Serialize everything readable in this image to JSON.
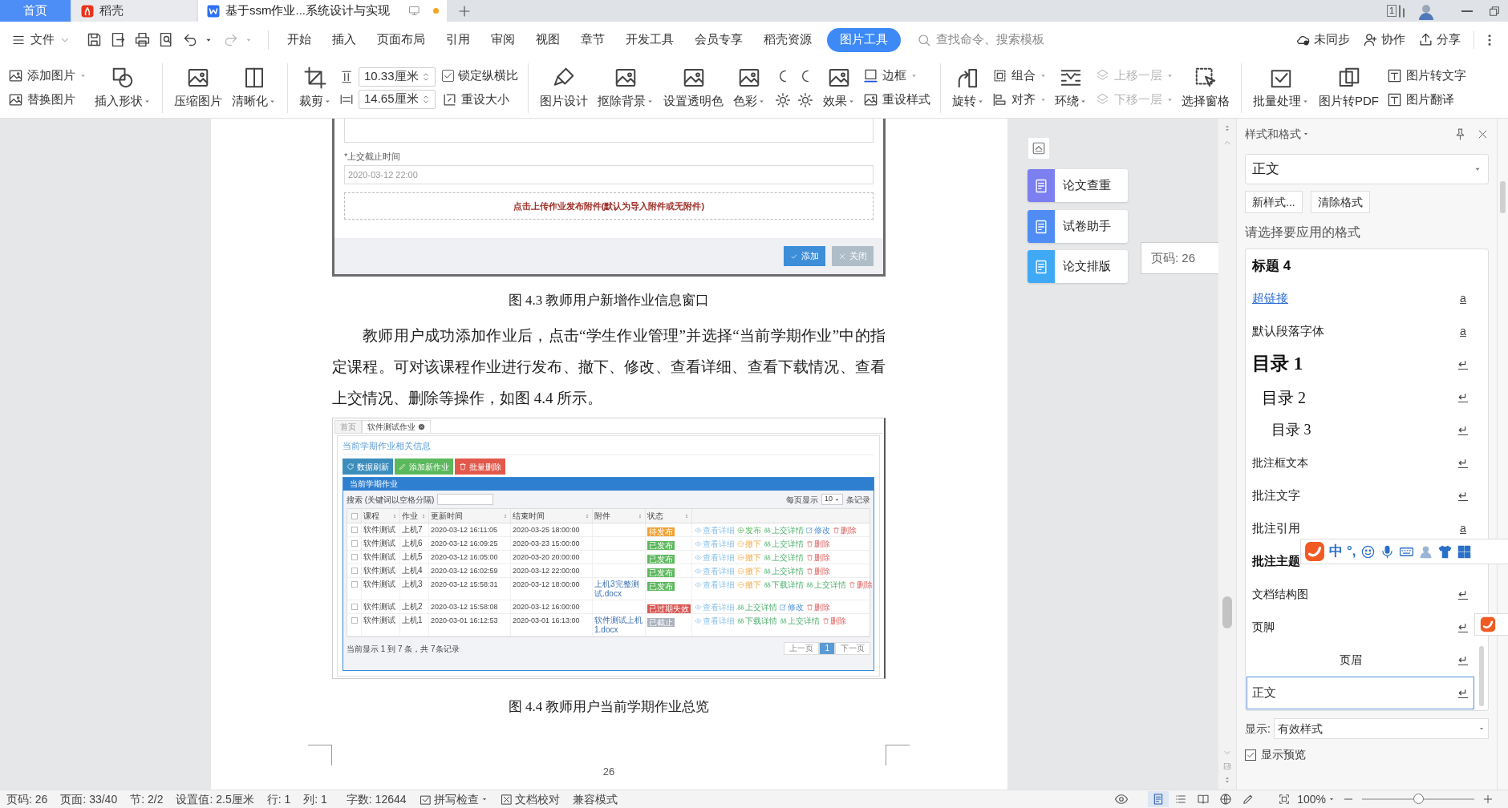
{
  "title_bar": {
    "tabs": [
      {
        "label": "首页",
        "kind": "home",
        "selected": false,
        "unsaved": false
      },
      {
        "label": "稻壳",
        "kind": "docer",
        "selected": false,
        "unsaved": false
      },
      {
        "label": "基于ssm作业...系统设计与实现",
        "kind": "document",
        "selected": true,
        "unsaved": true
      }
    ],
    "window_count": "1"
  },
  "menu_bar": {
    "file": "文件",
    "tabs": [
      {
        "label": "开始",
        "selected": false
      },
      {
        "label": "插入",
        "selected": false
      },
      {
        "label": "页面布局",
        "selected": false
      },
      {
        "label": "引用",
        "selected": false
      },
      {
        "label": "审阅",
        "selected": false
      },
      {
        "label": "视图",
        "selected": false
      },
      {
        "label": "章节",
        "selected": false
      },
      {
        "label": "开发工具",
        "selected": false
      },
      {
        "label": "会员专享",
        "selected": false
      },
      {
        "label": "稻壳资源",
        "selected": false
      },
      {
        "label": "图片工具",
        "selected": true
      }
    ],
    "search": {
      "placeholder": "查找命令、搜索模板"
    },
    "actions": [
      "未同步",
      "协作",
      "分享"
    ]
  },
  "ribbon": {
    "groups": [
      {
        "columns": [
          {
            "kind": "stack",
            "items": [
              {
                "kind": "button",
                "label": "添加图片",
                "dropdown": true,
                "disabled": false
              },
              {
                "kind": "button",
                "label": "替换图片",
                "dropdown": false,
                "disabled": false
              }
            ]
          },
          {
            "kind": "large",
            "label": "插入形状",
            "dropdown": true
          }
        ]
      },
      {
        "columns": [
          {
            "kind": "large",
            "label": "压缩图片",
            "dropdown": false
          },
          {
            "kind": "large",
            "label": "清晰化",
            "dropdown": true
          }
        ]
      },
      {
        "columns": [
          {
            "kind": "large",
            "label": "裁剪",
            "dropdown": true
          },
          {
            "kind": "size",
            "fields": [
              {
                "value": "10.33厘米"
              },
              {
                "value": "14.65厘米"
              }
            ]
          },
          {
            "kind": "stack",
            "items": [
              {
                "kind": "checkbox",
                "label": "锁定纵横比",
                "checked": true
              },
              {
                "kind": "button",
                "label": "重设大小",
                "dropdown": false,
                "disabled": false
              }
            ]
          }
        ]
      },
      {
        "columns": [
          {
            "kind": "large",
            "label": "图片设计",
            "dropdown": false
          },
          {
            "kind": "large",
            "label": "抠除背景",
            "dropdown": true
          },
          {
            "kind": "large",
            "label": "设置透明色",
            "dropdown": false
          },
          {
            "kind": "large",
            "label": "色彩",
            "dropdown": true
          },
          {
            "kind": "icon-grid"
          },
          {
            "kind": "large",
            "label": "效果",
            "dropdown": true
          },
          {
            "kind": "stack",
            "items": [
              {
                "kind": "button",
                "label": "边框",
                "dropdown": true,
                "disabled": false
              },
              {
                "kind": "button",
                "label": "重设样式",
                "dropdown": false,
                "disabled": false
              }
            ]
          }
        ]
      },
      {
        "columns": [
          {
            "kind": "large",
            "label": "旋转",
            "dropdown": true
          },
          {
            "kind": "stack",
            "items": [
              {
                "kind": "button",
                "label": "组合",
                "dropdown": true,
                "disabled": false
              },
              {
                "kind": "button",
                "label": "对齐",
                "dropdown": true,
                "disabled": false
              }
            ]
          },
          {
            "kind": "large",
            "label": "环绕",
            "dropdown": true
          },
          {
            "kind": "stack",
            "items": [
              {
                "kind": "button",
                "label": "上移一层",
                "dropdown": true,
                "disabled": true
              },
              {
                "kind": "button",
                "label": "下移一层",
                "dropdown": true,
                "disabled": true
              }
            ]
          },
          {
            "kind": "large",
            "label": "选择窗格",
            "dropdown": false
          }
        ]
      },
      {
        "columns": [
          {
            "kind": "large",
            "label": "批量处理",
            "dropdown": true
          },
          {
            "kind": "large",
            "label": "图片转PDF",
            "dropdown": false
          },
          {
            "kind": "stack",
            "items": [
              {
                "kind": "button",
                "label": "图片转文字",
                "dropdown": false,
                "disabled": false
              },
              {
                "kind": "button",
                "label": "图片翻译",
                "dropdown": false,
                "disabled": false
              }
            ]
          }
        ]
      }
    ]
  },
  "document": {
    "dialog": {
      "field_label": "*上交截止时间",
      "field_value": "2020-03-12 22:00",
      "upload_text": "点击上传作业发布附件(默认为导入附件或无附件)",
      "buttons": [
        {
          "label": "添加",
          "kind": "primary"
        },
        {
          "label": "关闭",
          "kind": "secondary"
        }
      ]
    },
    "caption_1": "图 4.3 教师用户新增作业信息窗口",
    "paragraph": "教师用户成功添加作业后，点击“学生作业管理”并选择“当前学期作业”中的指定课程。可对该课程作业进行发布、撤下、修改、查看详细、查看下载情况、查看上交情况、删除等操作，如图 4.4 所示。",
    "screenshot": {
      "tabs": [
        {
          "label": "首页",
          "selected": false
        },
        {
          "label": "软件测试作业",
          "selected": true
        }
      ],
      "heading": "当前学期作业相关信息",
      "buttons": [
        {
          "label": "数据刷新",
          "kind": "refresh"
        },
        {
          "label": "添加新作业",
          "kind": "add"
        },
        {
          "label": "批量删除",
          "kind": "delete"
        }
      ],
      "panel_title": "当前学期作业",
      "header_checked": false,
      "search_label": "搜索 (关键词以空格分隔)",
      "page_size_label": "每页显示",
      "page_size": "10",
      "records_label": "条记录",
      "columns": [
        "课程",
        "作业",
        "更新时间",
        "结束时间",
        "附件",
        "状态"
      ],
      "rows": [
        {
          "checked": false,
          "course": "软件测试",
          "assignment": "上机7",
          "updated": "2020-03-12 16:11:05",
          "ends": "2020-03-25 18:00:00",
          "status": {
            "label": "待发布",
            "kind": "pending"
          },
          "actions": [
            {
              "label": "查看详细",
              "kind": "view"
            },
            {
              "label": "发布",
              "kind": "publish"
            },
            {
              "label": "上交详情",
              "kind": "submissions"
            },
            {
              "label": "修改",
              "kind": "edit"
            },
            {
              "label": "删除",
              "kind": "delete"
            }
          ]
        },
        {
          "checked": false,
          "course": "软件测试",
          "assignment": "上机6",
          "updated": "2020-03-12 16:09:25",
          "ends": "2020-03-23 15:00:00",
          "status": {
            "label": "已发布",
            "kind": "published"
          },
          "actions": [
            {
              "label": "查看详细",
              "kind": "view"
            },
            {
              "label": "撤下",
              "kind": "withdraw"
            },
            {
              "label": "上交详情",
              "kind": "submissions"
            },
            {
              "label": "删除",
              "kind": "delete"
            }
          ]
        },
        {
          "checked": false,
          "course": "软件测试",
          "assignment": "上机5",
          "updated": "2020-03-12 16:05:00",
          "ends": "2020-03-20 20:00:00",
          "status": {
            "label": "已发布",
            "kind": "published"
          },
          "actions": [
            {
              "label": "查看详细",
              "kind": "view"
            },
            {
              "label": "撤下",
              "kind": "withdraw"
            },
            {
              "label": "上交详情",
              "kind": "submissions"
            },
            {
              "label": "删除",
              "kind": "delete"
            }
          ]
        },
        {
          "checked": false,
          "course": "软件测试",
          "assignment": "上机4",
          "updated": "2020-03-12 16:02:59",
          "ends": "2020-03-12 22:00:00",
          "status": {
            "label": "已发布",
            "kind": "published"
          },
          "actions": [
            {
              "label": "查看详细",
              "kind": "view"
            },
            {
              "label": "撤下",
              "kind": "withdraw"
            },
            {
              "label": "上交详情",
              "kind": "submissions"
            },
            {
              "label": "删除",
              "kind": "delete"
            }
          ]
        },
        {
          "checked": false,
          "course": "软件测试",
          "assignment": "上机3",
          "updated": "2020-03-12 15:58:31",
          "ends": "2020-03-12 18:00:00",
          "attachment": "上机3完整测试.docx",
          "status": {
            "label": "已发布",
            "kind": "published"
          },
          "actions": [
            {
              "label": "查看详细",
              "kind": "view"
            },
            {
              "label": "撤下",
              "kind": "withdraw"
            },
            {
              "label": "下载详情",
              "kind": "download"
            },
            {
              "label": "上交详情",
              "kind": "submissions"
            },
            {
              "label": "删除",
              "kind": "delete"
            }
          ]
        },
        {
          "checked": false,
          "course": "软件测试",
          "assignment": "上机2",
          "updated": "2020-03-12 15:58:08",
          "ends": "2020-03-12 16:00:00",
          "status": {
            "label": "已过期失效",
            "kind": "expired"
          },
          "actions": [
            {
              "label": "查看详细",
              "kind": "view"
            },
            {
              "label": "上交详情",
              "kind": "submissions"
            },
            {
              "label": "修改",
              "kind": "edit"
            },
            {
              "label": "删除",
              "kind": "delete"
            }
          ]
        },
        {
          "checked": false,
          "course": "软件测试",
          "assignment": "上机1",
          "updated": "2020-03-01 16:12:53",
          "ends": "2020-03-01 16:13:00",
          "attachment": "软件测试上机1.docx",
          "status": {
            "label": "已截止",
            "kind": "closed"
          },
          "actions": [
            {
              "label": "查看详细",
              "kind": "view"
            },
            {
              "label": "下载详情",
              "kind": "download"
            },
            {
              "label": "上交详情",
              "kind": "submissions"
            },
            {
              "label": "删除",
              "kind": "delete"
            }
          ]
        }
      ],
      "footer": "当前显示 1 到 7 条，共 7条记录",
      "pagination": [
        {
          "label": "上一页",
          "selected": false
        },
        {
          "label": "1",
          "selected": true
        },
        {
          "label": "下一页",
          "selected": false
        }
      ]
    },
    "caption_2": "图 4.4 教师用户当前学期作业总览",
    "page_number": "26"
  },
  "side_tools": [
    {
      "label": "论文查重"
    },
    {
      "label": "试卷助手"
    },
    {
      "label": "论文排版"
    }
  ],
  "page_tooltip": "页码: 26",
  "styles_panel": {
    "title": "样式和格式",
    "current_style": "正文",
    "buttons": [
      "新样式...",
      "清除格式"
    ],
    "prompt": "请选择要应用的格式",
    "styles": [
      {
        "label": "标题 4",
        "kind": "heading4",
        "selected": false
      },
      {
        "label": "超链接",
        "kind": "link",
        "mark": "a",
        "selected": false
      },
      {
        "label": "默认段落字体",
        "kind": "plain",
        "mark": "a",
        "selected": false
      },
      {
        "label": "目录 1",
        "kind": "toc1",
        "mark": "↵",
        "selected": false
      },
      {
        "label": "目录 2",
        "kind": "toc2",
        "mark": "↵",
        "selected": false
      },
      {
        "label": "目录 3",
        "kind": "toc3",
        "mark": "↵",
        "selected": false
      },
      {
        "label": "批注框文本",
        "kind": "small",
        "mark": "↵",
        "selected": false
      },
      {
        "label": "批注文字",
        "kind": "plain",
        "mark": "↵",
        "selected": false
      },
      {
        "label": "批注引用",
        "kind": "plain",
        "mark": "a",
        "selected": false
      },
      {
        "label": "批注主题",
        "kind": "bold",
        "selected": false
      },
      {
        "label": "文档结构图",
        "kind": "small",
        "mark": "↵",
        "selected": false
      },
      {
        "label": "页脚",
        "kind": "small",
        "mark": "↵",
        "selected": false
      },
      {
        "label": "页眉",
        "kind": "center",
        "mark": "↵",
        "selected": false
      },
      {
        "label": "正文",
        "kind": "plain",
        "mark": "↵",
        "selected": true
      }
    ],
    "show_label": "显示:",
    "show_value": "有效样式",
    "preview": {
      "label": "显示预览",
      "checked": true
    }
  },
  "ime_toolbar": {
    "items": [
      "中",
      "°,"
    ]
  },
  "status_bar": {
    "items": [
      "页码: 26",
      "页面: 33/40",
      "节: 2/2",
      "设置值: 2.5厘米",
      "行: 1",
      "列: 1",
      "字数: 12644"
    ],
    "spell_check": {
      "label": "拼写检查",
      "checked": true
    },
    "proofread": "文档校对",
    "mode": "兼容模式",
    "zoom": "100%",
    "zoom_slider": {
      "level": 0.5
    }
  }
}
